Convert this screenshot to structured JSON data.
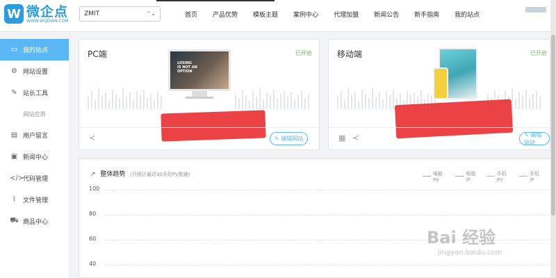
{
  "header": {
    "logo": {
      "name": "微企点",
      "url": "WWW.WQDIAN.COM",
      "mark": "W"
    },
    "site_select": {
      "value": "ZMIT",
      "arrow": "⌃⌄"
    },
    "nav": [
      "首页",
      "产品优势",
      "模板主题",
      "案例中心",
      "代理加盟",
      "新闻公告",
      "新手指南",
      "我的站点"
    ]
  },
  "sidebar": {
    "items": [
      {
        "label": "我的站点",
        "icon": "monitor-icon",
        "glyph": "▭"
      },
      {
        "label": "网站设置",
        "icon": "gear-icon",
        "glyph": "⚙"
      },
      {
        "label": "站长工具",
        "icon": "wrench-icon",
        "glyph": "✎"
      }
    ],
    "group_label": "网站应用",
    "apps": [
      {
        "label": "用户留言",
        "icon": "message-icon",
        "glyph": "▤"
      },
      {
        "label": "新闻中心",
        "icon": "news-icon",
        "glyph": "▣"
      },
      {
        "label": "代码管理",
        "icon": "code-icon",
        "glyph": "</>"
      },
      {
        "label": "文件管理",
        "icon": "paperclip-icon",
        "glyph": "⌇"
      },
      {
        "label": "商品中心",
        "icon": "cart-icon",
        "glyph": "⛟"
      }
    ]
  },
  "pc_card": {
    "title": "PC端",
    "status": "已开启",
    "screen_text": "LOSING\nIS NOT AN\nOPTION",
    "edit_label": "✎ 编辑网站",
    "share_glyph": "≺"
  },
  "mobile_card": {
    "title": "移动端",
    "status": "已开启",
    "edit_label": "✎ 编辑网站",
    "qr_glyph": "▦",
    "share_glyph": "≺"
  },
  "trend": {
    "title": "整体趋势",
    "subtitle": "(只统计最近30天的PV数据)",
    "icon_glyph": "↗",
    "legend": [
      {
        "label": "电脑PV",
        "color": "#5bb8f5"
      },
      {
        "label": "电脑IP",
        "color": "#5bb8f5"
      },
      {
        "label": "手机PV",
        "color": "#9ad07a"
      },
      {
        "label": "手机IP",
        "color": "#9ad07a"
      }
    ],
    "y_ticks": [
      "100",
      "80",
      "60",
      "40"
    ]
  },
  "watermark": {
    "main": "Bai 经验",
    "sub": "jingyan.baidu.com"
  }
}
